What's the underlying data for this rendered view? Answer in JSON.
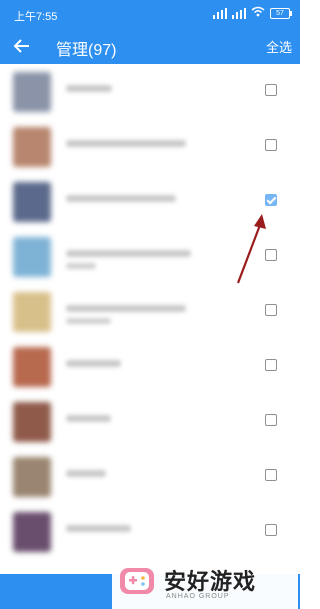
{
  "status_bar": {
    "time": "上午7:55",
    "battery": "57"
  },
  "app_bar": {
    "back_icon": "arrow-left-icon",
    "title": "管理(97)",
    "select_all": "全选"
  },
  "items": [
    {
      "checked": false,
      "thumb_color": "#8a93a8"
    },
    {
      "checked": false,
      "thumb_color": "#b8866e"
    },
    {
      "checked": true,
      "thumb_color": "#5b6a8c"
    },
    {
      "checked": false,
      "thumb_color": "#7fb3d6"
    },
    {
      "checked": false,
      "thumb_color": "#d8c08a"
    },
    {
      "checked": false,
      "thumb_color": "#b86a4e"
    },
    {
      "checked": false,
      "thumb_color": "#8f5a4a"
    },
    {
      "checked": false,
      "thumb_color": "#9a8670"
    },
    {
      "checked": false,
      "thumb_color": "#6a4e6e"
    }
  ],
  "watermark": {
    "brand": "安好游戏",
    "sub": "ANHAO GROUP"
  },
  "colors": {
    "primary": "#2d8ff0",
    "annotation_arrow": "#9b1c1c"
  }
}
